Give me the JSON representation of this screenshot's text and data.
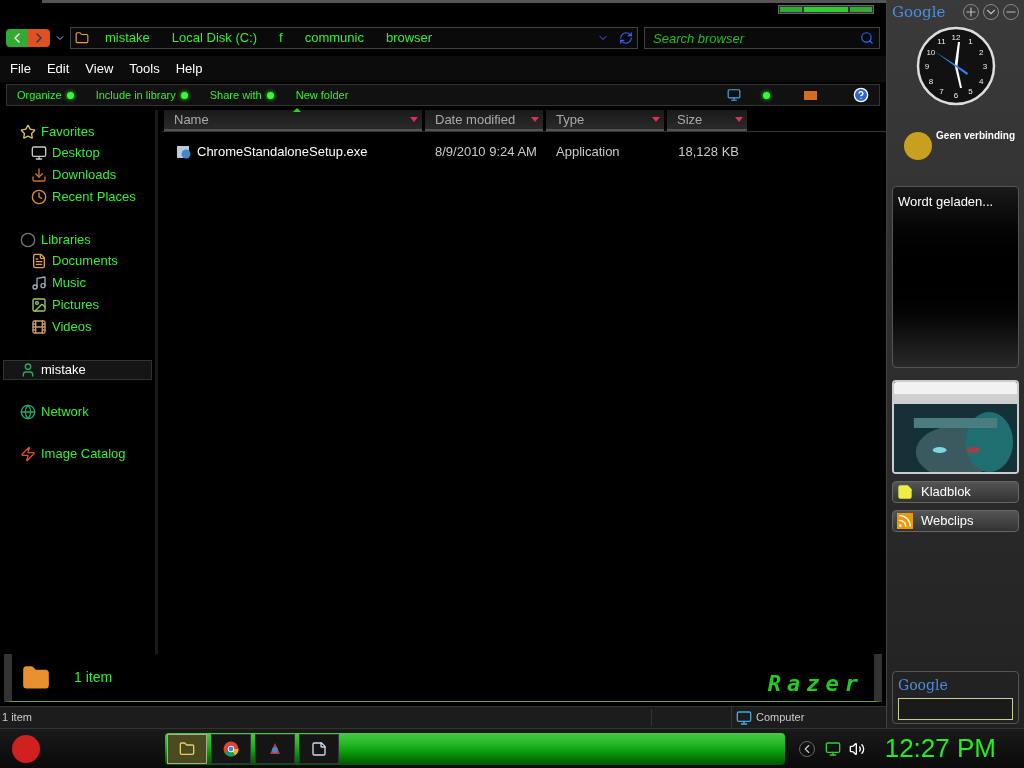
{
  "address_bar": {
    "segments": [
      "mistake",
      "Local Disk (C:)",
      "f",
      "communic",
      "browser"
    ]
  },
  "search": {
    "placeholder": "Search browser"
  },
  "menu": [
    "File",
    "Edit",
    "View",
    "Tools",
    "Help"
  ],
  "toolbar": [
    {
      "label": "Organize",
      "has_menu": true
    },
    {
      "label": "Include in library",
      "has_menu": true
    },
    {
      "label": "Share with",
      "has_menu": true
    },
    {
      "label": "New folder",
      "has_menu": false
    }
  ],
  "navigation": [
    {
      "label": "Favorites",
      "kind": "star",
      "selected": false,
      "children": [
        {
          "label": "Desktop",
          "kind": "desktop"
        },
        {
          "label": "Downloads",
          "kind": "download"
        },
        {
          "label": "Recent Places",
          "kind": "recent"
        }
      ]
    },
    {
      "label": "Libraries",
      "kind": "library",
      "selected": false,
      "children": [
        {
          "label": "Documents",
          "kind": "document"
        },
        {
          "label": "Music",
          "kind": "music"
        },
        {
          "label": "Pictures",
          "kind": "picture"
        },
        {
          "label": "Videos",
          "kind": "video"
        }
      ]
    },
    {
      "label": "mistake",
      "kind": "user",
      "selected": true
    },
    {
      "label": "Network",
      "kind": "network",
      "selected": false
    },
    {
      "label": "Image Catalog",
      "kind": "catalog",
      "selected": false
    }
  ],
  "columns": [
    {
      "label": "Name",
      "sorted": true
    },
    {
      "label": "Date modified",
      "sorted": false
    },
    {
      "label": "Type",
      "sorted": false
    },
    {
      "label": "Size",
      "sorted": false
    }
  ],
  "rows": [
    {
      "name": "ChromeStandaloneSetup.exe",
      "date": "8/9/2010 9:24 AM",
      "type": "Application",
      "size": "18,128 KB"
    }
  ],
  "details": {
    "count": "1 item",
    "logo": "Razer"
  },
  "status_bar": {
    "count": "1 item",
    "location": "Computer"
  },
  "gadgets": {
    "logo": "Google",
    "clock_numerals": [
      "12",
      "1",
      "2",
      "3",
      "4",
      "5",
      "6",
      "7",
      "8",
      "9",
      "10",
      "11"
    ],
    "weather_status": "Geen verbinding",
    "feed_status": "Wordt geladen...",
    "buttons": [
      {
        "label": "Kladblok",
        "kind": "note"
      },
      {
        "label": "Webclips",
        "kind": "feed"
      }
    ],
    "search_logo": "Google"
  },
  "taskbar": {
    "apps": [
      {
        "kind": "explorer",
        "selected": true
      },
      {
        "kind": "chrome",
        "selected": false
      },
      {
        "kind": "app",
        "selected": false
      },
      {
        "kind": "notepad",
        "selected": false
      }
    ],
    "clock": "12:27 PM"
  }
}
